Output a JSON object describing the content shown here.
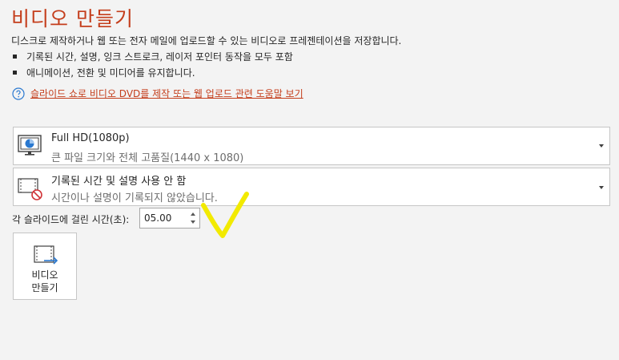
{
  "title": "비디오 만들기",
  "description": "디스크로 제작하거나 웹 또는 전자 메일에 업로드할 수 있는 비디오로 프레젠테이션을 저장합니다.",
  "bullets": [
    "기록된 시간, 설명, 잉크 스트로크, 레이저 포인터 동작을 모두 포함",
    "애니메이션, 전환 및 미디어를 유지합니다."
  ],
  "help_link": "슬라이드 쇼로 비디오 DVD를 제작 또는 웹 업로드 관련 도움말 보기",
  "quality_dropdown": {
    "title": "Full HD(1080p)",
    "subtitle": "큰 파일 크기와 전체 고품질(1440 x 1080)"
  },
  "timing_dropdown": {
    "title": "기록된 시간 및 설명 사용 안 함",
    "subtitle": "시간이나 설명이 기록되지 않았습니다."
  },
  "seconds_label": "각 슬라이드에 걸린 시간(초):",
  "seconds_value": "05.00",
  "create_button": {
    "line1": "비디오",
    "line2": "만들기"
  },
  "colors": {
    "accent": "#c43e1c",
    "link_icon": "#2b79d0",
    "annotation": "#f2ea00"
  }
}
